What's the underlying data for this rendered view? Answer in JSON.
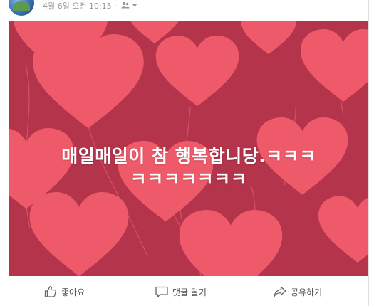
{
  "post": {
    "timestamp": "4월 6일 오전 10:15",
    "privacy_icon": "friends-icon",
    "dropdown_icon": "caret-down-icon"
  },
  "image": {
    "caption_line1": "매일매일이 참 행복합니당.ㅋㅋㅋ",
    "caption_line2": "ㅋㅋㅋㅋㅋㅋㅋ",
    "background_color": "#b3344b",
    "heart_color": "#ee5a6a"
  },
  "actions": {
    "like_label": "좋아요",
    "comment_label": "댓글 달기",
    "share_label": "공유하기"
  }
}
